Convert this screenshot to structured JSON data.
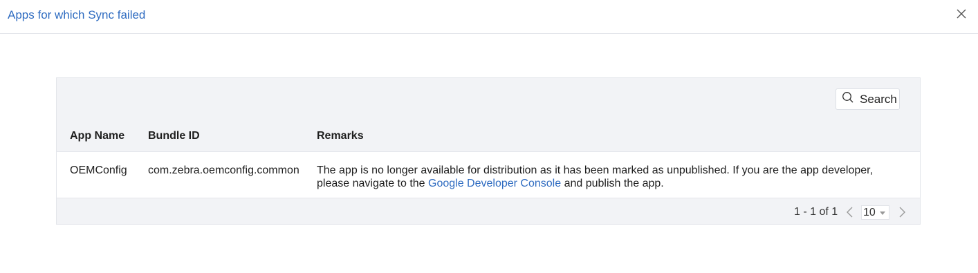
{
  "dialog": {
    "title": "Apps for which Sync failed",
    "close_icon": "close-icon"
  },
  "toolbar": {
    "search_label": "Search",
    "search_icon": "search-icon"
  },
  "table": {
    "columns": [
      "App Name",
      "Bundle ID",
      "Remarks"
    ],
    "rows": [
      {
        "app_name": "OEMConfig",
        "bundle_id": "com.zebra.oemconfig.common",
        "remarks_before": "The app is no longer available for distribution as it has been marked as unpublished. If you are the app developer, please navigate to the ",
        "remarks_link": "Google Developer Console",
        "remarks_after": " and publish the app."
      }
    ]
  },
  "pagination": {
    "range_text": "1 - 1 of 1",
    "page_size": "10",
    "prev_icon": "chevron-left-icon",
    "next_icon": "chevron-right-icon"
  },
  "colors": {
    "accent": "#2f6cc1",
    "panel_bg": "#f2f3f6"
  }
}
